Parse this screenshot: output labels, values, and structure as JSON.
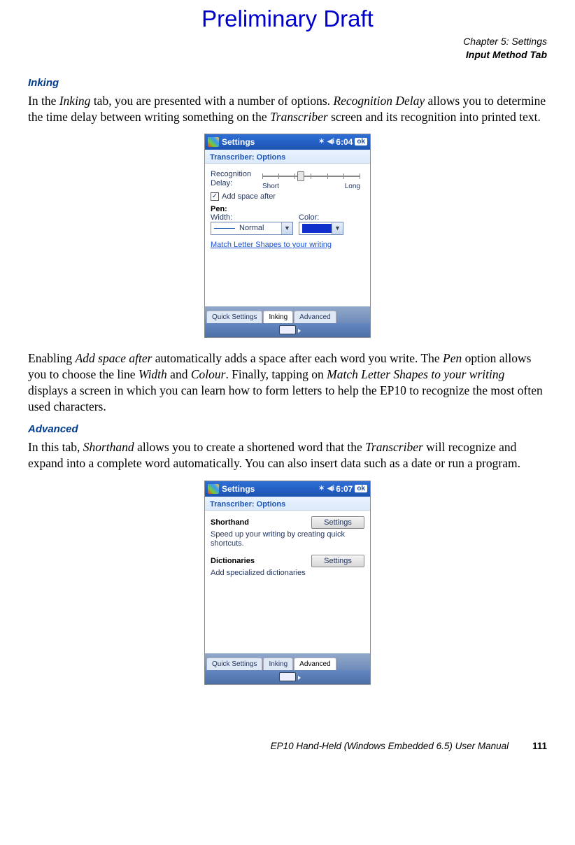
{
  "draft_title": "Preliminary Draft",
  "header": {
    "chapter": "Chapter 5: Settings",
    "section": "Input Method Tab"
  },
  "inking": {
    "heading": "Inking",
    "para1_parts": [
      "In the ",
      "Inking",
      " tab, you are presented with a number of options. ",
      "Recognition Delay",
      " allows you to determine the time delay between writing something on the ",
      "Transcriber",
      " screen and its recognition into printed text."
    ],
    "para2_parts": [
      "Enabling ",
      "Add space after",
      " automatically adds a space after each word you write. The ",
      "Pen",
      " option allows you to choose the line ",
      "Width",
      " and ",
      "Colour",
      ". Finally, tapping on ",
      "Match Letter Shapes to your writing",
      " displays a screen in which you can learn how to form letters to help the EP10 to recognize the most often used characters."
    ]
  },
  "advanced": {
    "heading": "Advanced",
    "para_parts": [
      "In this tab, ",
      "Shorthand",
      " allows you to create a shortened word that the ",
      "Transcriber",
      " will recognize and expand into a complete word automatically. You can also insert data such as a date or run a program."
    ]
  },
  "shot_common": {
    "titlebar_label": "Settings",
    "ok": "ok",
    "subtitle": "Transcriber: Options",
    "tabs": {
      "quick": "Quick Settings",
      "inking": "Inking",
      "advanced": "Advanced"
    }
  },
  "shot1": {
    "time": "6:04",
    "recog_label": "Recognition Delay:",
    "slider_short": "Short",
    "slider_long": "Long",
    "add_space": "Add space after",
    "pen_heading": "Pen:",
    "width_label": "Width:",
    "color_label": "Color:",
    "width_value": "Normal",
    "link": "Match Letter Shapes to your writing"
  },
  "shot2": {
    "time": "6:07",
    "shorthand_label": "Shorthand",
    "shorthand_desc": "Speed up your writing by creating quick shortcuts.",
    "dict_label": "Dictionaries",
    "dict_desc": "Add specialized dictionaries",
    "settings_btn": "Settings"
  },
  "footer": {
    "manual": "EP10 Hand-Held (Windows Embedded 6.5) User Manual",
    "page_num": "111"
  }
}
